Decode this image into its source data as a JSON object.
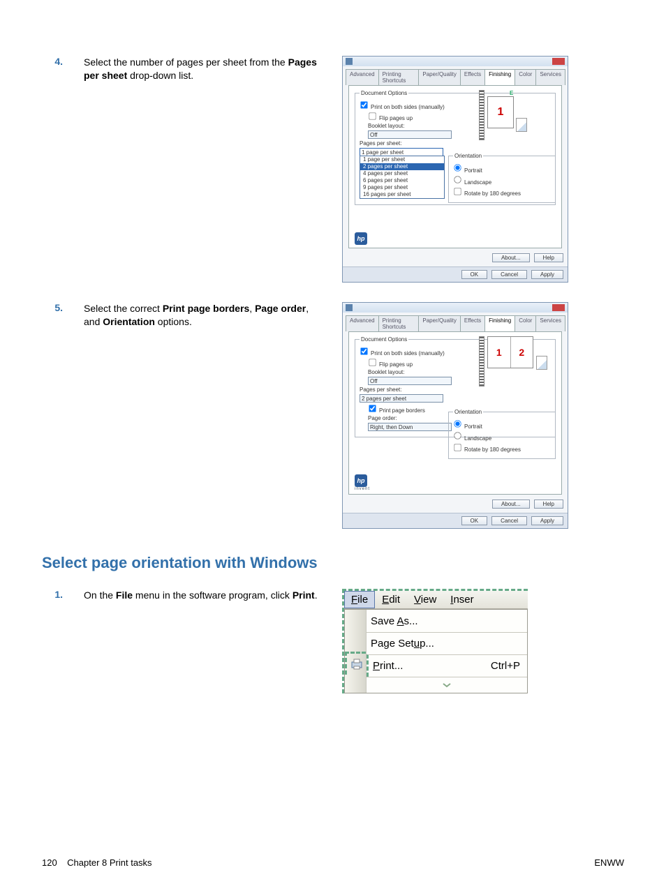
{
  "steps": {
    "s4": {
      "num": "4.",
      "text_pre": "Select the number of pages per sheet from the ",
      "bold": "Pages per sheet",
      "text_post": " drop-down list."
    },
    "s5": {
      "num": "5.",
      "text_pre": "Select the correct ",
      "b1": "Print page borders",
      "sep1": ", ",
      "b2": "Page order",
      "sep2": ", and ",
      "b3": "Orientation",
      "text_post": " options."
    },
    "s1": {
      "num": "1.",
      "text_pre": "On the ",
      "b1": "File",
      "mid": " menu in the software program, click ",
      "b2": "Print",
      "post": "."
    }
  },
  "heading": "Select page orientation with Windows",
  "dialog": {
    "tabs": [
      "Advanced",
      "Printing Shortcuts",
      "Paper/Quality",
      "Effects",
      "Finishing",
      "Color",
      "Services"
    ],
    "active_tab": 4,
    "group1": "Document Options",
    "cb_duplex": "Print on both sides (manually)",
    "cb_flip": "Flip pages up",
    "lbl_booklet": "Booklet layout:",
    "sel_booklet": "Off",
    "lbl_pps": "Pages per sheet:",
    "sel_pps": "1 page per sheet",
    "pps_options": [
      "1 page per sheet",
      "2 pages per sheet",
      "4 pages per sheet",
      "6 pages per sheet",
      "9 pages per sheet",
      "16 pages per sheet"
    ],
    "pps_sel_idx": 1,
    "sel_pps_5": "2 pages per sheet",
    "cb_borders": "Print page borders",
    "lbl_pageorder": "Page order:",
    "sel_pageorder": "Right, then Down",
    "group_orient": "Orientation",
    "r_portrait": "Portrait",
    "r_landscape": "Landscape",
    "cb_rotate": "Rotate by 180 degrees",
    "btn_about": "About...",
    "btn_help": "Help",
    "btn_ok": "OK",
    "btn_cancel": "Cancel",
    "btn_apply": "Apply",
    "hp": "hp",
    "invent": "invent",
    "preview_letter_e": "E",
    "preview_digit_1": "1",
    "preview_digit_2": "2"
  },
  "filemenu": {
    "bar": [
      "File",
      "Edit",
      "View",
      "Inser"
    ],
    "item_saveas": "Save As...",
    "item_pagesetup": "Page Setup...",
    "item_print": "Print...",
    "item_print_short": "Ctrl+P",
    "expand": "▾"
  },
  "footer": {
    "page_no": "120",
    "chapter": "Chapter 8   Print tasks",
    "right": "ENWW"
  }
}
